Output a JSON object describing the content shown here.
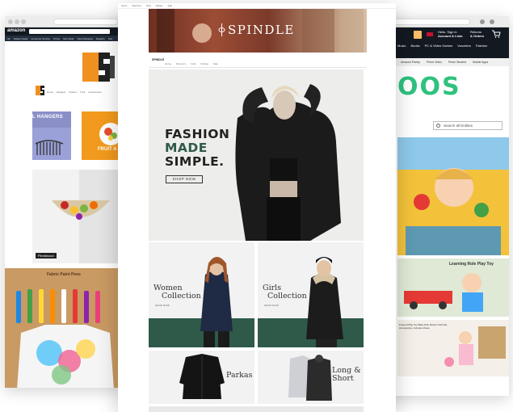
{
  "left_window": {
    "logo_text": "amazon",
    "nav_items": [
      "All",
      "Todays Deals",
      "Customer Service",
      "Prime",
      "Gift Cards",
      "New Releases",
      "Registry",
      "Sell"
    ],
    "store_tabs": [
      "Home",
      "Hangers",
      "Kitchen",
      "Fruit",
      "Accessories"
    ],
    "hangers_label": "L HANGERS",
    "fruit_label": "FRUIT A",
    "bowl_tag": "Plentiwood",
    "paint_label": "Fabric Paint Pens"
  },
  "right_window": {
    "account_line1": "Hello, Sign in",
    "account_line2": "Account & Lists",
    "returns_line1": "Returns",
    "returns_line2": "& Orders",
    "nav_items": [
      "Music",
      "Books",
      "PC & Video Games",
      "Vouchers",
      "Fashion"
    ],
    "subnav_items": [
      "Amazon Pantry",
      "Prime Video",
      "Prime Student",
      "Mobile Apps"
    ],
    "brand_fragment": "OOS",
    "search_placeholder": "Search all Entities",
    "toy_label": "Learning Role Play Toy",
    "doll_label": "Pretend Play Toy Baby Doll, Reborn Doll Set, Accessories, includes shoes"
  },
  "center_window": {
    "brand": "SPINDLE",
    "subnav_brand": "SPINDLE",
    "subnav_links": [
      "Home",
      "Women's",
      "Girls",
      "Parkas",
      "Sale"
    ],
    "headline_line1": "FASHION",
    "headline_line2": "MADE",
    "headline_line3": "SIMPLE.",
    "shop_now": "SHOP NOW",
    "women_title_1": "Women",
    "women_title_2": "Collection",
    "women_shop": "SHOP NOW",
    "girls_title_1": "Girls",
    "girls_title_2": "Collection",
    "girls_shop": "SHOP NOW",
    "parkas_title": "Parkas",
    "long_title_1": "Long &",
    "long_title_2": "Short",
    "accent_color": "#2f5a4a"
  }
}
